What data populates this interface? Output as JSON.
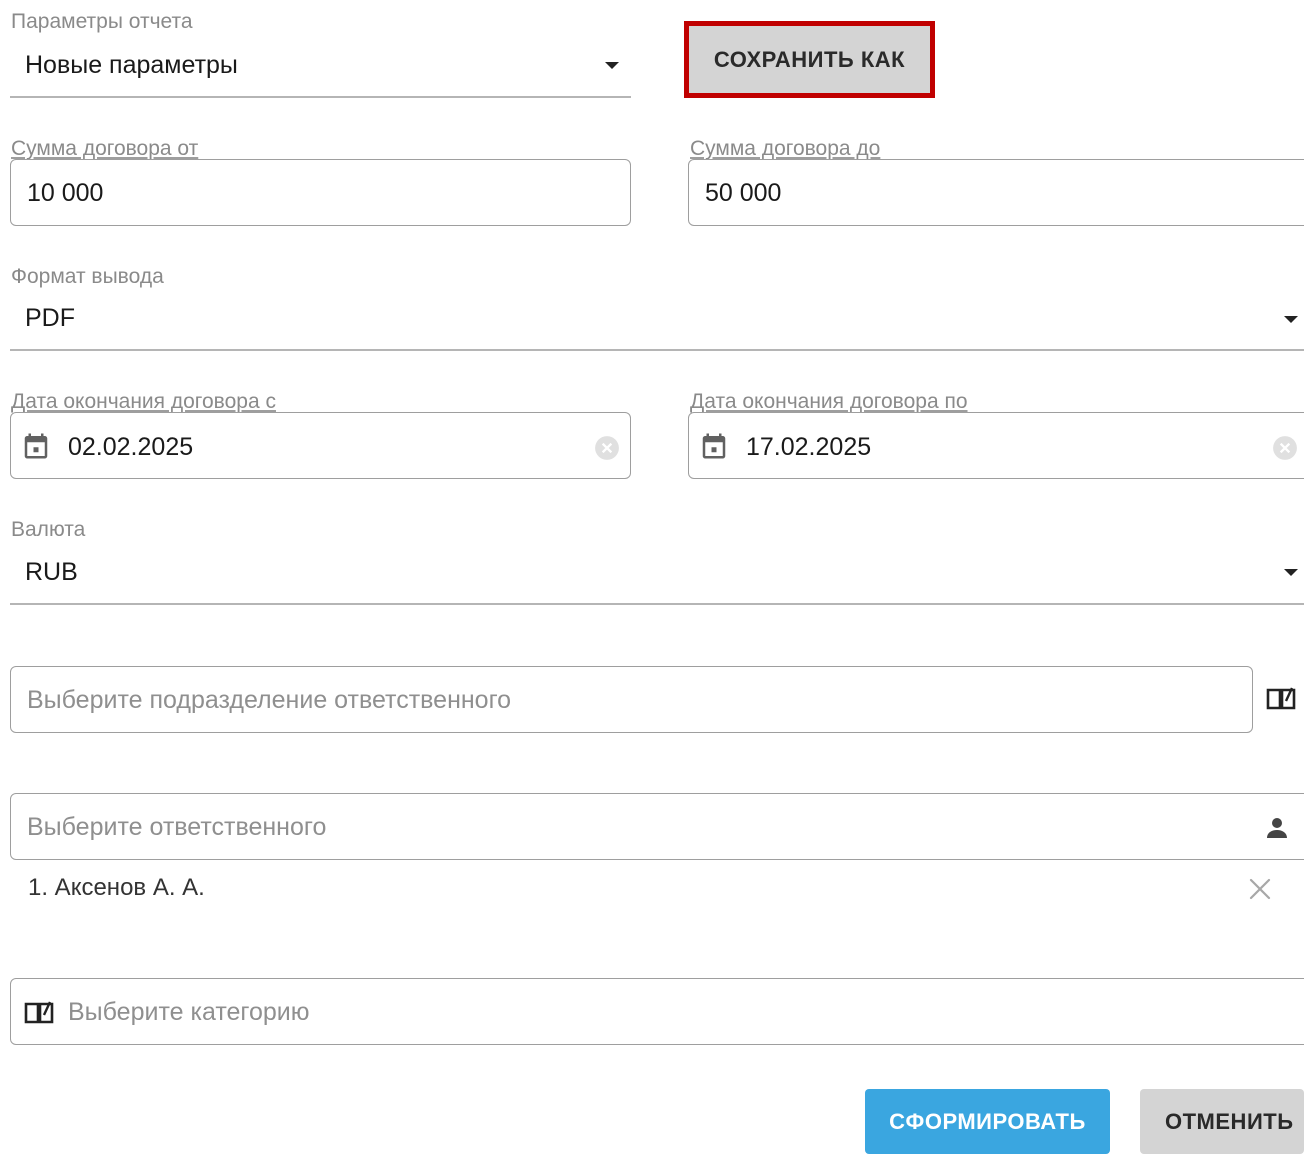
{
  "report_params": {
    "label": "Параметры отчета",
    "value": "Новые параметры"
  },
  "save_as_button": "СОХРАНИТЬ КАК",
  "amount_from": {
    "label": "Сумма договора от",
    "value": "10 000"
  },
  "amount_to": {
    "label": "Сумма договора до",
    "value": "50 000"
  },
  "output_format": {
    "label": "Формат вывода",
    "value": "PDF"
  },
  "end_date_from": {
    "label": "Дата окончания договора с",
    "value": "02.02.2025"
  },
  "end_date_to": {
    "label": "Дата окончания договора по",
    "value": "17.02.2025"
  },
  "currency": {
    "label": "Валюта",
    "value": "RUB"
  },
  "department": {
    "placeholder": "Выберите подразделение ответственного"
  },
  "responsible": {
    "placeholder": "Выберите ответственного",
    "selected": [
      {
        "text": "1. Аксенов А. А."
      }
    ]
  },
  "category": {
    "placeholder": "Выберите категорию"
  },
  "actions": {
    "generate": "СФОРМИРОВАТЬ",
    "cancel": "ОТМЕНИТЬ"
  },
  "colors": {
    "primary": "#3aa6e0",
    "highlight": "#c00000",
    "gray_button": "#d4d4d4"
  },
  "icons": [
    "chevron-down-icon",
    "calendar-icon",
    "clear-icon",
    "book-icon",
    "person-icon",
    "remove-icon"
  ]
}
